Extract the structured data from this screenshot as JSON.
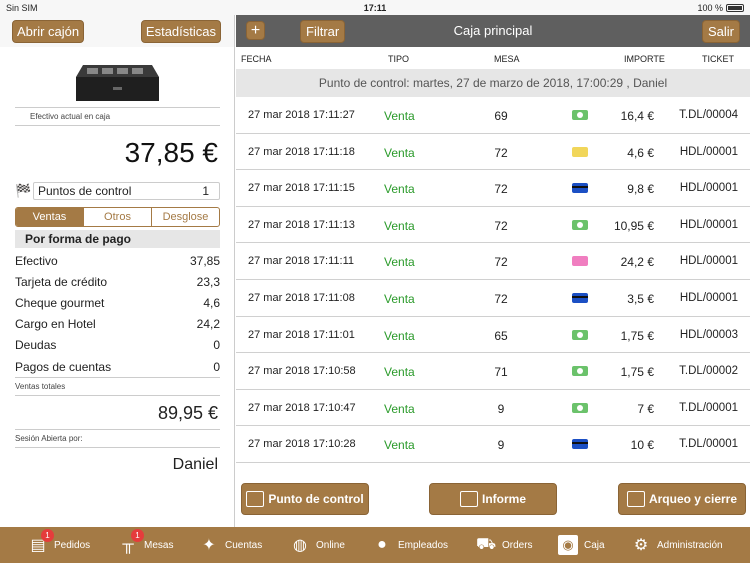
{
  "statusbar": {
    "carrier": "Sin SIM",
    "time": "17:11",
    "battery": "100 %"
  },
  "left": {
    "open_drawer": "Abrir cajón",
    "stats": "Estadísticas",
    "current_cash_label": "Efectivo actual en caja",
    "current_cash": "37,85 €",
    "control_points_label": "Puntos de control",
    "control_points_count": "1",
    "segments": [
      "Ventas",
      "Otros",
      "Desglose"
    ],
    "pay_header": "Por forma de pago",
    "payments": [
      {
        "name": "Efectivo",
        "value": "37,85"
      },
      {
        "name": "Tarjeta de crédito",
        "value": "23,3"
      },
      {
        "name": "Cheque gourmet",
        "value": "4,6"
      },
      {
        "name": "Cargo en Hotel",
        "value": "24,2"
      },
      {
        "name": "Deudas",
        "value": "0"
      },
      {
        "name": "Pagos de cuentas",
        "value": "0"
      }
    ],
    "total_sales_label": "Ventas totales",
    "total_sales": "89,95 €",
    "session_label": "Sesión Abierta por:",
    "session_user": "Daniel"
  },
  "topbar": {
    "add": "+",
    "filter": "Filtrar",
    "title": "Caja principal",
    "exit": "Salir"
  },
  "table": {
    "headers": {
      "fecha": "FECHA",
      "tipo": "TIPO",
      "mesa": "MESA",
      "importe": "IMPORTE",
      "ticket": "TICKET"
    },
    "control_point": "Punto de control: martes, 27 de marzo de 2018, 17:00:29 , Daniel",
    "rows": [
      {
        "fecha": "27 mar 2018 17:11:27",
        "tipo": "Venta",
        "mesa": "69",
        "pay": "cash",
        "importe": "16,4 €",
        "ticket": "T.DL/00004"
      },
      {
        "fecha": "27 mar 2018 17:11:18",
        "tipo": "Venta",
        "mesa": "72",
        "pay": "gold",
        "importe": "4,6 €",
        "ticket": "HDL/00001"
      },
      {
        "fecha": "27 mar 2018 17:11:15",
        "tipo": "Venta",
        "mesa": "72",
        "pay": "card",
        "importe": "9,8 €",
        "ticket": "HDL/00001"
      },
      {
        "fecha": "27 mar 2018 17:11:13",
        "tipo": "Venta",
        "mesa": "72",
        "pay": "cash",
        "importe": "10,95 €",
        "ticket": "HDL/00001"
      },
      {
        "fecha": "27 mar 2018 17:11:11",
        "tipo": "Venta",
        "mesa": "72",
        "pay": "pink",
        "importe": "24,2 €",
        "ticket": "HDL/00001"
      },
      {
        "fecha": "27 mar 2018 17:11:08",
        "tipo": "Venta",
        "mesa": "72",
        "pay": "card",
        "importe": "3,5 €",
        "ticket": "HDL/00001"
      },
      {
        "fecha": "27 mar 2018 17:11:01",
        "tipo": "Venta",
        "mesa": "65",
        "pay": "cash",
        "importe": "1,75 €",
        "ticket": "HDL/00003"
      },
      {
        "fecha": "27 mar 2018 17:10:58",
        "tipo": "Venta",
        "mesa": "71",
        "pay": "cash",
        "importe": "1,75 €",
        "ticket": "T.DL/00002"
      },
      {
        "fecha": "27 mar 2018 17:10:47",
        "tipo": "Venta",
        "mesa": "9",
        "pay": "cash",
        "importe": "7 €",
        "ticket": "T.DL/00001"
      },
      {
        "fecha": "27 mar 2018 17:10:28",
        "tipo": "Venta",
        "mesa": "9",
        "pay": "card",
        "importe": "10 €",
        "ticket": "T.DL/00001"
      }
    ]
  },
  "actions": {
    "control_point": "Punto de control",
    "report": "Informe",
    "close": "Arqueo y cierre"
  },
  "tabs": [
    {
      "label": "Pedidos",
      "icon": "orders-icon",
      "badge": "1"
    },
    {
      "label": "Mesas",
      "icon": "table-icon",
      "badge": "1"
    },
    {
      "label": "Cuentas",
      "icon": "accounts-icon",
      "badge": ""
    },
    {
      "label": "Online",
      "icon": "globe-icon",
      "badge": ""
    },
    {
      "label": "Empleados",
      "icon": "employee-icon",
      "badge": ""
    },
    {
      "label": "Orders",
      "icon": "cart-icon",
      "badge": ""
    },
    {
      "label": "Caja",
      "icon": "safe-icon",
      "badge": ""
    },
    {
      "label": "Administración",
      "icon": "gear-icon",
      "badge": ""
    }
  ],
  "colors": {
    "brand": "#a47a45",
    "header": "#5f5f5f",
    "sale_green": "#2a9a2a",
    "badge": "#e53c3c"
  }
}
